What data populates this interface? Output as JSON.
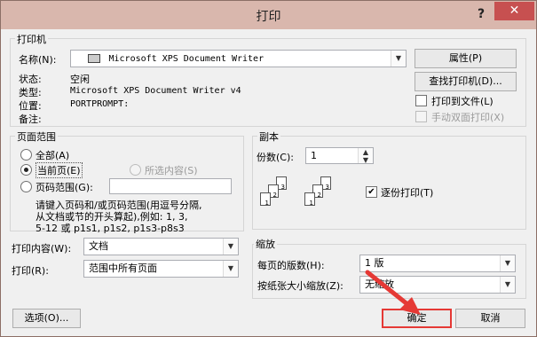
{
  "window": {
    "title": "打印",
    "help_glyph": "?",
    "close_glyph": "✕"
  },
  "printer": {
    "legend": "打印机",
    "name_label": "名称(N):",
    "name_value": "Microsoft XPS Document Writer",
    "status_label": "状态:",
    "status_value": "空闲",
    "type_label": "类型:",
    "type_value": "Microsoft XPS Document Writer v4",
    "location_label": "位置:",
    "location_value": "PORTPROMPT:",
    "comment_label": "备注:",
    "properties_button": "属性(P)",
    "find_printer_button": "查找打印机(D)...",
    "print_to_file_label": "打印到文件(L)",
    "manual_duplex_label": "手动双面打印(X)"
  },
  "page_range": {
    "legend": "页面范围",
    "all_label": "全部(A)",
    "current_label": "当前页(E)",
    "selection_label": "所选内容(S)",
    "pages_label": "页码范围(G):",
    "pages_value": "",
    "hint_line1": "请键入页码和/或页码范围(用逗号分隔,",
    "hint_line2": "从文档或节的开头算起),例如: 1, 3,",
    "hint_line3": "5-12 或 p1s1, p1s2, p1s3-p8s3"
  },
  "copies": {
    "legend": "副本",
    "count_label": "份数(C):",
    "count_value": "1",
    "collate_label": "逐份打印(T)",
    "collate_checked": true,
    "page_labels": [
      "3",
      "2",
      "1",
      "3",
      "2",
      "1"
    ]
  },
  "print_what": {
    "label": "打印内容(W):",
    "value": "文档"
  },
  "print": {
    "label": "打印(R):",
    "value": "范围中所有页面"
  },
  "zoom": {
    "legend": "缩放",
    "pages_per_sheet_label": "每页的版数(H):",
    "pages_per_sheet_value": "1 版",
    "scale_label": "按纸张大小缩放(Z):",
    "scale_value": "无缩放"
  },
  "footer": {
    "options_button": "选项(O)...",
    "ok_button": "确定",
    "cancel_button": "取消"
  },
  "colors": {
    "highlight": "#e53935",
    "title_bg": "#d9b7ad",
    "close_bg": "#c75050"
  }
}
